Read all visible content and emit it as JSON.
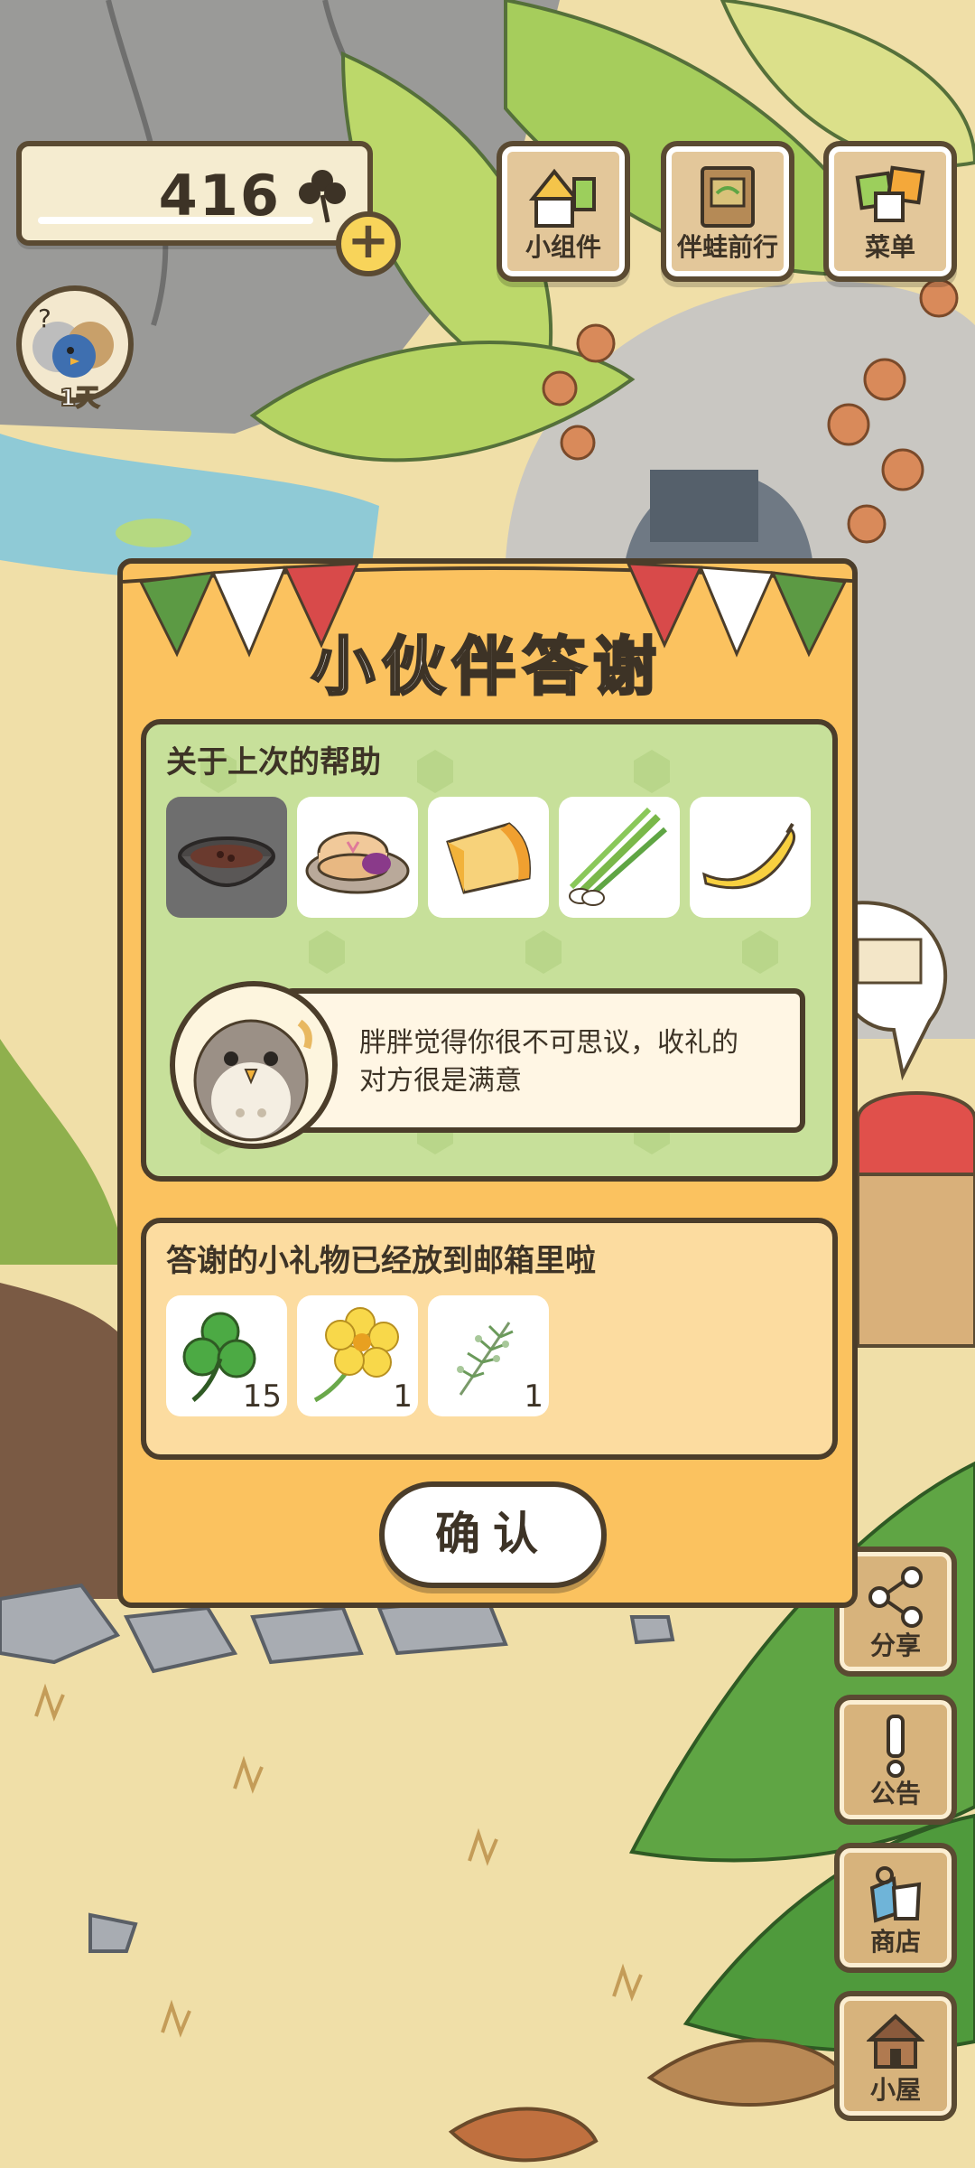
{
  "hud": {
    "clover_count": "416",
    "plus_label": "+",
    "avatar_days": "1天"
  },
  "top_buttons": [
    {
      "label": "小组件",
      "icon": "widget-icon"
    },
    {
      "label": "伴蛙前行",
      "icon": "journey-book-icon"
    },
    {
      "label": "菜单",
      "icon": "menu-icon"
    }
  ],
  "side_buttons": [
    {
      "label": "分享",
      "icon": "share-icon"
    },
    {
      "label": "公告",
      "icon": "announcement-icon"
    },
    {
      "label": "商店",
      "icon": "shop-bags-icon"
    },
    {
      "label": "小屋",
      "icon": "house-icon"
    }
  ],
  "dialog": {
    "title": "小伙伴答谢",
    "help_section": {
      "title": "关于上次的帮助",
      "items": [
        {
          "icon": "bowl-of-soup-icon",
          "selected": true
        },
        {
          "icon": "mooncake-icon",
          "selected": false
        },
        {
          "icon": "cheese-icon",
          "selected": false
        },
        {
          "icon": "green-onion-icon",
          "selected": false
        },
        {
          "icon": "banana-icon",
          "selected": false
        }
      ],
      "friend_icon": "owl-friend-icon",
      "message_line1": "胖胖觉得你很不可思议，收礼的",
      "message_line2": "对方很是满意"
    },
    "gift_section": {
      "title": "答谢的小礼物已经放到邮箱里啦",
      "gifts": [
        {
          "icon": "clover-icon",
          "count": "15"
        },
        {
          "icon": "yellow-flower-icon",
          "count": "1"
        },
        {
          "icon": "herb-sprig-icon",
          "count": "1"
        }
      ]
    },
    "confirm_label": "确认"
  },
  "colors": {
    "dialog_bg": "#fbc25f",
    "help_panel_bg": "#c7e09a",
    "gift_panel_bg": "#fcdca0",
    "outline": "#4b3d2a"
  }
}
